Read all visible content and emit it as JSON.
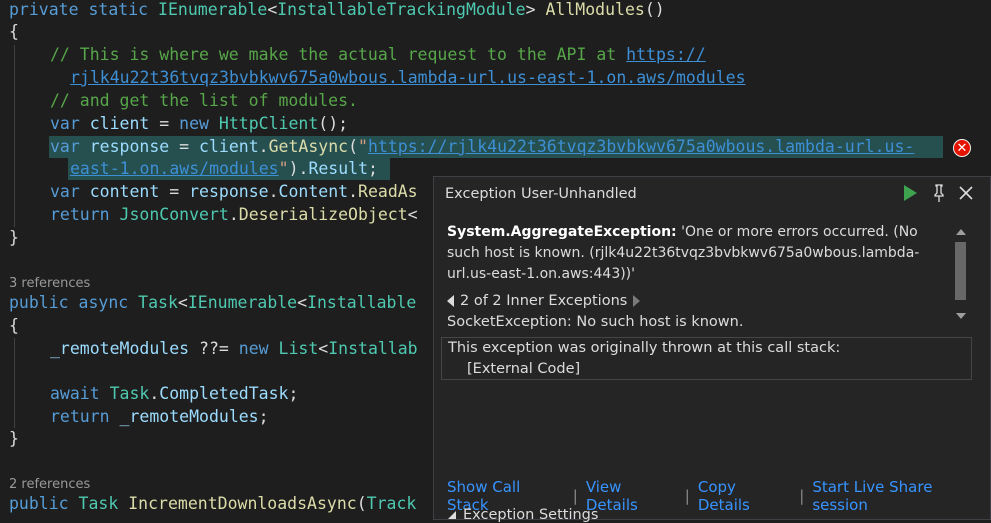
{
  "code": {
    "l1": {
      "k1": "private",
      "k2": "static",
      "t1": "IEnumerable",
      "p1": "<",
      "t2": "InstallableTrackingModule",
      "p2": ">",
      "f1": "AllModules",
      "p3": "()"
    },
    "l2": {
      "p": "{"
    },
    "l3": {
      "c": "// This is where we make the actual request to the API at ",
      "u": "https://"
    },
    "l4": {
      "u": "rjlk4u22t36tvqz3bvbkwv675a0wbous.lambda-url.us-east-1.on.aws/modules"
    },
    "l5": {
      "c": "// and get the list of modules."
    },
    "l6": {
      "k1": "var",
      "v": "client",
      "p1": "=",
      "k2": "new",
      "t": "HttpClient",
      "p2": "();"
    },
    "l7": {
      "k1": "var",
      "v": "response",
      "p1": "=",
      "v2": "client",
      "p2": ".",
      "f": "GetAsync",
      "p3": "(",
      "s1": "\"",
      "u": "https://rjlk4u22t36tvqz3bvbkwv675a0wbous.lambda-url.us-"
    },
    "l8": {
      "u": "east-1.on.aws/modules",
      "s2": "\"",
      "p": ").",
      "v": "Result",
      "p2": ";"
    },
    "l9": {
      "k1": "var",
      "v": "content",
      "p1": "=",
      "v2": "response",
      "p2": ".",
      "v3": "Content",
      "p3": ".",
      "f": "ReadAs"
    },
    "l10": {
      "k": "return",
      "t": "JsonConvert",
      "p1": ".",
      "f": "DeserializeObject",
      "p2": "<"
    },
    "l11": {
      "p": "}"
    },
    "lens1": "3 references",
    "l12": {
      "k1": "public",
      "k2": "async",
      "t1": "Task",
      "p1": "<",
      "t2": "IEnumerable",
      "p2": "<",
      "t3": "Installable"
    },
    "l13": {
      "p": "{"
    },
    "l14": {
      "v": "_remoteModules",
      "p1": "??=",
      "k": "new",
      "t": "List",
      "p2": "<",
      "t2": "Installab"
    },
    "l15": {
      "k": "await",
      "t": "Task",
      "p1": ".",
      "v": "CompletedTask",
      "p2": ";"
    },
    "l16": {
      "k": "return",
      "v": "_remoteModules",
      "p": ";"
    },
    "l17": {
      "p": "}"
    },
    "lens2": "2 references",
    "l18": {
      "k1": "public",
      "t1": "Task",
      "f": "IncrementDownloadsAsync",
      "p": "(",
      "t2": "Track"
    }
  },
  "popup": {
    "title": "Exception User-Unhandled",
    "exception_type": "System.AggregateException:",
    "message_line1": " 'One or more errors occurred. (No",
    "message_line2": "such host is known. (rjlk4u22t36tvqz3bvbkwv675a0wbous.lambda-",
    "message_line3": "url.us-east-1.on.aws:443))'",
    "inner_nav": "2 of 2 Inner Exceptions",
    "inner_message": "SocketException: No such host is known.",
    "stack_header": "This exception was originally thrown at this call stack:",
    "stack_entry": "[External Code]",
    "links": {
      "show_call_stack": "Show Call Stack",
      "view_details": "View Details",
      "copy_details": "Copy Details",
      "live_share": "Start Live Share session"
    },
    "separator": "|",
    "settings_label": "Exception Settings"
  },
  "colors": {
    "background": "#1e1e1e",
    "popup_bg": "#252526",
    "error_red": "#e51400",
    "link_blue": "#3794ff",
    "run_green": "#3ea24f"
  }
}
